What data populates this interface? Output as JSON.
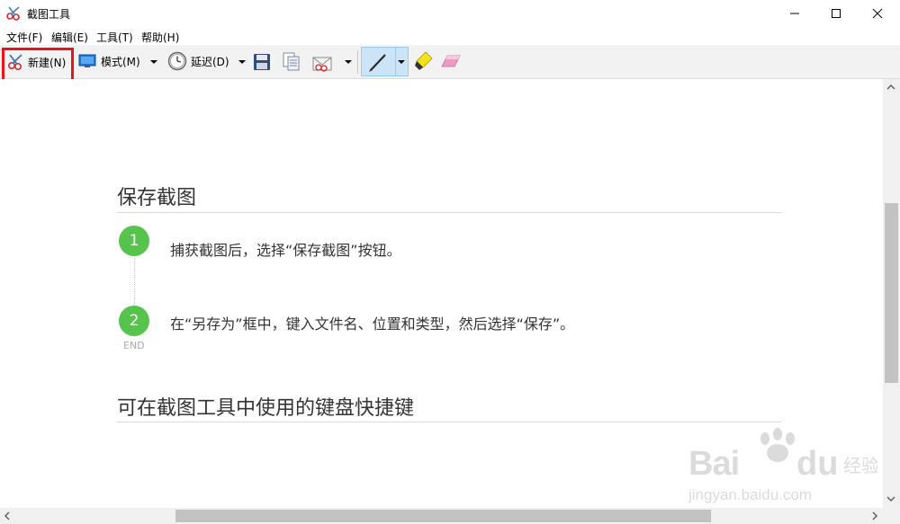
{
  "window": {
    "title": "截图工具"
  },
  "menu": [
    "文件(F)",
    "编辑(E)",
    "工具(T)",
    "帮助(H)"
  ],
  "toolbar": {
    "new_label": "新建(N)",
    "mode_label": "模式(M)",
    "delay_label": "延迟(D)"
  },
  "content": {
    "section1_title": "保存截图",
    "steps": [
      {
        "num": "1",
        "text": "捕获截图后，选择“保存截图”按钮。"
      },
      {
        "num": "2",
        "text": "在“另存为”框中，键入文件名、位置和类型，然后选择“保存”。"
      }
    ],
    "end_label": "END",
    "section2_title": "可在截图工具中使用的键盘快捷键"
  },
  "watermark": {
    "brand": "Bai du 经验",
    "url": "jingyan.baidu.com"
  },
  "colors": {
    "accent_green": "#56c34c",
    "highlight_red": "#e8141b",
    "toolbar_bg": "#f2f2f2"
  }
}
